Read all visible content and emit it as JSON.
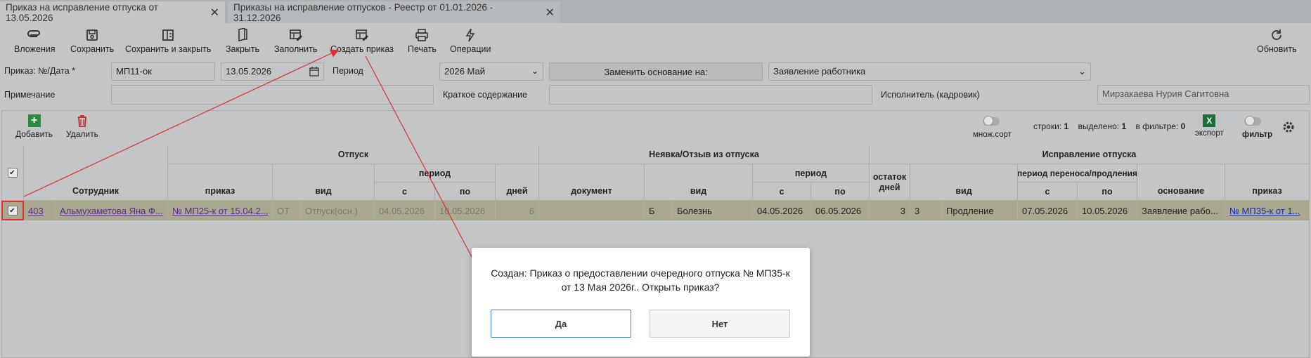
{
  "tabs": [
    {
      "label": "Приказ на исправление отпуска от 13.05.2026",
      "active": true
    },
    {
      "label": "Приказы на исправление отпусков - Реестр от 01.01.2026 - 31.12.2026",
      "active": false
    }
  ],
  "toolbar": {
    "attachments": "Вложения",
    "save": "Сохранить",
    "save_close": "Сохранить и закрыть",
    "close": "Закрыть",
    "fill": "Заполнить",
    "create_order": "Создать приказ",
    "print": "Печать",
    "operations": "Операции",
    "refresh": "Обновить"
  },
  "form": {
    "order_label": "Приказ: №/Дата *",
    "order_number": "МП11-ок",
    "order_date": "13.05.2026",
    "period_label": "Период",
    "period_value": "2026 Май",
    "replace_basis_button": "Заменить основание на:",
    "basis_value": "Заявление работника",
    "note_label": "Примечание",
    "note_value": "",
    "summary_label": "Краткое содержание",
    "summary_value": "",
    "executor_label": "Исполнитель (кадровик)",
    "executor_value": "Мирзакаева Нурия Сагитовна"
  },
  "grid_toolbar": {
    "add": "Добавить",
    "delete": "Удалить",
    "multi_sort": "множ.сорт",
    "rows_label": "строки:",
    "rows_count": "1",
    "selected_label": "выделено:",
    "selected_count": "1",
    "in_filter_label": "в фильтре:",
    "in_filter_count": "0",
    "export": "экспорт",
    "filter": "фильтр"
  },
  "table": {
    "group_vacation": "Отпуск",
    "group_absence": "Неявка/Отзыв из отпуска",
    "group_correction": "Исправление отпуска",
    "sub_period": "период",
    "sub_period2": "период",
    "sub_transfer_period": "период переноса/продления",
    "col_employee": "Сотрудник",
    "col_order": "приказ",
    "col_type": "вид",
    "col_from": "с",
    "col_to": "по",
    "col_days": "дней",
    "col_document": "документ",
    "col_abs_type": "вид",
    "col_abs_from": "с",
    "col_abs_to": "по",
    "col_remaining_1": "остаток",
    "col_remaining_2": "дней",
    "col_corr_type": "вид",
    "col_corr_from": "с",
    "col_corr_to": "по",
    "col_basis": "основание",
    "col_corr_order": "приказ",
    "row": {
      "tab_no": "403",
      "employee": "Альмухаметова Яна Ф...",
      "order": "№ МП25-к от 15.04.2...",
      "type_code": "ОТ",
      "type": "Отпуск(осн.)",
      "from": "04.05.2026",
      "to": "10.05.2026",
      "days": "6",
      "document": "",
      "abs_code": "Б",
      "abs_type": "Болезнь",
      "abs_from": "04.05.2026",
      "abs_to": "06.05.2026",
      "remaining": "3",
      "corr_code": "3",
      "corr_type": "Продление",
      "corr_from": "07.05.2026",
      "corr_to": "10.05.2026",
      "basis": "Заявление рабо...",
      "corr_order": "№ МП35-к от 1..."
    }
  },
  "dialog": {
    "message": "Создан: Приказ о предоставлении очередного отпуска № МП35-к от 13 Мая 2026г.. Открыть приказ?",
    "yes": "Да",
    "no": "Нет"
  },
  "colors": {
    "selected_row": "#aaa88e",
    "annotation_red": "#e03030",
    "export_green": "#1f6e3a",
    "add_green": "#2b8a3e",
    "delete_red": "#c0272d"
  }
}
